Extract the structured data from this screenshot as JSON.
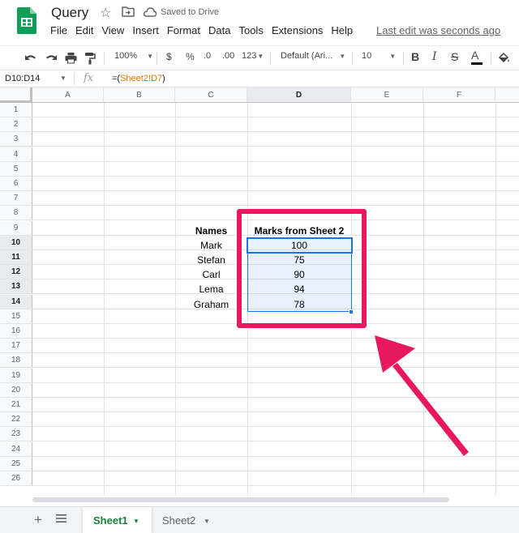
{
  "app": {
    "title": "Query",
    "saved_status": "Saved to Drive",
    "last_edit": "Last edit was seconds ago",
    "accent_color": "#188038",
    "highlight_color": "#e8185f"
  },
  "menu": [
    "File",
    "Edit",
    "View",
    "Insert",
    "Format",
    "Data",
    "Tools",
    "Extensions",
    "Help"
  ],
  "toolbar": {
    "zoom": "100%",
    "currency": "$",
    "percent": "%",
    "decrease_decimal": ".0",
    "increase_decimal": ".00",
    "more_formats": "123",
    "font": "Default (Ari...",
    "font_size": "10",
    "bold": "B",
    "italic": "I",
    "strikethrough": "S",
    "text_color": "A"
  },
  "formula_bar": {
    "name_box": "D10:D14",
    "fx": "fx",
    "formula_prefix": "=(",
    "formula_ref": "Sheet2!D7",
    "formula_suffix": ")"
  },
  "columns": [
    "A",
    "B",
    "C",
    "D",
    "E",
    "F"
  ],
  "rows": [
    "1",
    "2",
    "3",
    "4",
    "5",
    "6",
    "7",
    "8",
    "9",
    "10",
    "11",
    "12",
    "13",
    "14",
    "15",
    "16",
    "17",
    "18",
    "19",
    "20",
    "21",
    "22",
    "23",
    "24",
    "25",
    "26"
  ],
  "table": {
    "header_names": "Names",
    "header_marks": "Marks from Sheet 2",
    "names": [
      "Mark",
      "Stefan",
      "Carl",
      "Lema",
      "Graham"
    ],
    "marks": [
      "100",
      "75",
      "90",
      "94",
      "78"
    ]
  },
  "tabs": {
    "active": "Sheet1",
    "inactive": "Sheet2"
  }
}
